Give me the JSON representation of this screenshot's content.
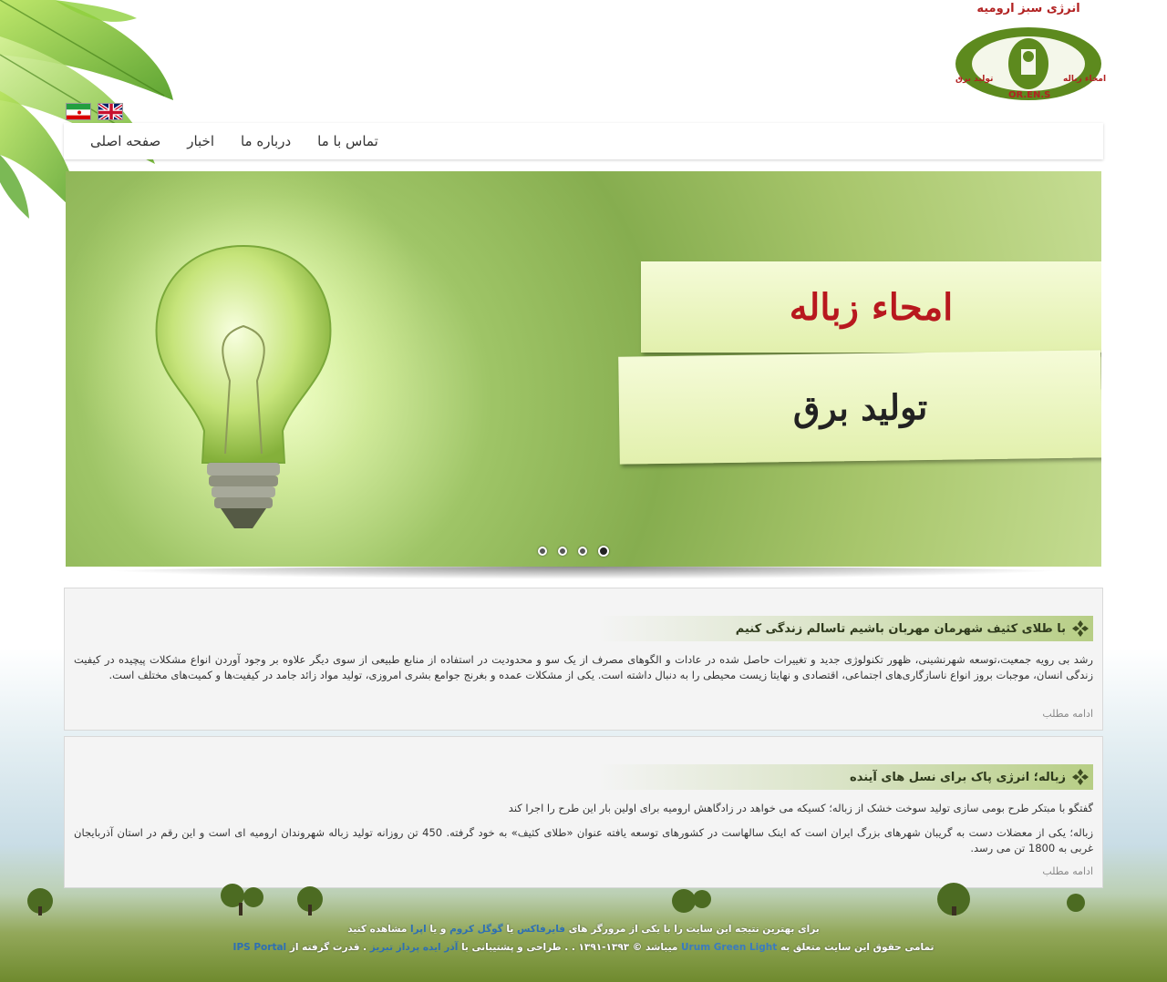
{
  "site": {
    "logo_title": "انرژی سبز ارومیه",
    "logo_text_right": "امحاء زباله",
    "logo_text_left": "تولید برق",
    "logo_abbr": "OR.EN.S"
  },
  "flags": [
    "iran-flag-icon",
    "uk-flag-icon"
  ],
  "nav": {
    "items": [
      {
        "label": "صفحه اصلی"
      },
      {
        "label": "اخبار"
      },
      {
        "label": "درباره ما"
      },
      {
        "label": "تماس با ما"
      }
    ]
  },
  "slider": {
    "banner1": "امحاء زباله",
    "banner2": "تولید برق",
    "slide_count": 4,
    "active_slide": 1
  },
  "articles": [
    {
      "title": "با طلای کثیف شهرمان مهربان باشیم تاسالم زندگی کنیم",
      "body": "رشد بی رویه جمعیت،توسعه شهرنشینی، ظهور تکنولوژی جدید و تغییرات حاصل شده در عادات و الگوهای مصرف از یک سو و محدودیت در استفاده از منابع طبیعی از سوی دیگر علاوه بر وجود آوردن انواع مشکلات پیچیده در کیفیت زندگی انسان، موجبات بروز انواع ناسازگاری‌های اجتماعی، اقتصادی و نهایتا زیست محیطی را به دنبال داشته است. یکی از مشکلات عمده و بغرنج جوامع بشری امروزی، تولید مواد زائد جامد در کیفیت‌ها و کمیت‌های مختلف است.",
      "more": "ادامه مطلب"
    },
    {
      "title": "زباله؛ انرژی پاک برای نسل های آینده",
      "body1": "گفتگو با مبتکر طرح بومی سازی تولید سوخت خشک از زباله؛ کسیکه می خواهد در زادگاهش ارومیه برای اولین بار این طرح را اجرا کند",
      "body2": "زباله؛ یکی از معضلات دست به گریبان شهرهای بزرگ ایران است که اینک سالهاست در کشورهای توسعه یافته عنوان «طلای کثیف» به خود گرفته. 450 تن روزانه تولید زباله شهروندان ارومیه ای است و این رقم در استان آذربایجان غربی به 1800 تن می رسد.",
      "more": "ادامه مطلب"
    }
  ],
  "footer": {
    "line1_a": "برای بهترین نتیجه این سایت را با یکی از مرورگر های",
    "firefox": "فایرفاکس",
    "line1_b": "یا",
    "chrome": "گوگل کروم",
    "line1_c": "و یا",
    "opera": "اپرا",
    "line1_d": "مشاهده کنید",
    "line2_a": "تمامی حقوق این سایت متعلق به",
    "brand": "Urum Green Light",
    "line2_b": "میباشد © ۱۳۹۳-۱۳۹۱ . . طراحی و پشتیبانی با",
    "designer": "آذر ایده پرداز تبریز",
    "line2_c": ". قدرت گرفته از",
    "powered": "IPS Portal"
  }
}
